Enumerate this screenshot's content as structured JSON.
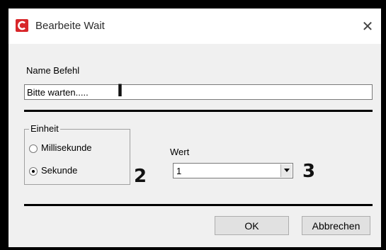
{
  "window": {
    "title": "Bearbeite Wait",
    "app_icon": "app-logo-icon",
    "close_icon": "close-icon",
    "close_symbol": "✕"
  },
  "form": {
    "name_label": "Name Befehl",
    "name_value": "Bitte warten.....",
    "unit_group_label": "Einheit",
    "unit_options": [
      {
        "label": "Millisekunde",
        "selected": false
      },
      {
        "label": "Sekunde",
        "selected": true
      }
    ],
    "value_label": "Wert",
    "value_selected": "1"
  },
  "annotations": {
    "marker_1": "I",
    "marker_2": "2",
    "marker_3": "3"
  },
  "buttons": {
    "ok_label": "OK",
    "cancel_label": "Abbrechen"
  },
  "colors": {
    "dialog_bg": "#f0f0f0",
    "titlebar_bg": "#ffffff",
    "app_icon_red": "#d8262a",
    "frame": "#000000"
  }
}
